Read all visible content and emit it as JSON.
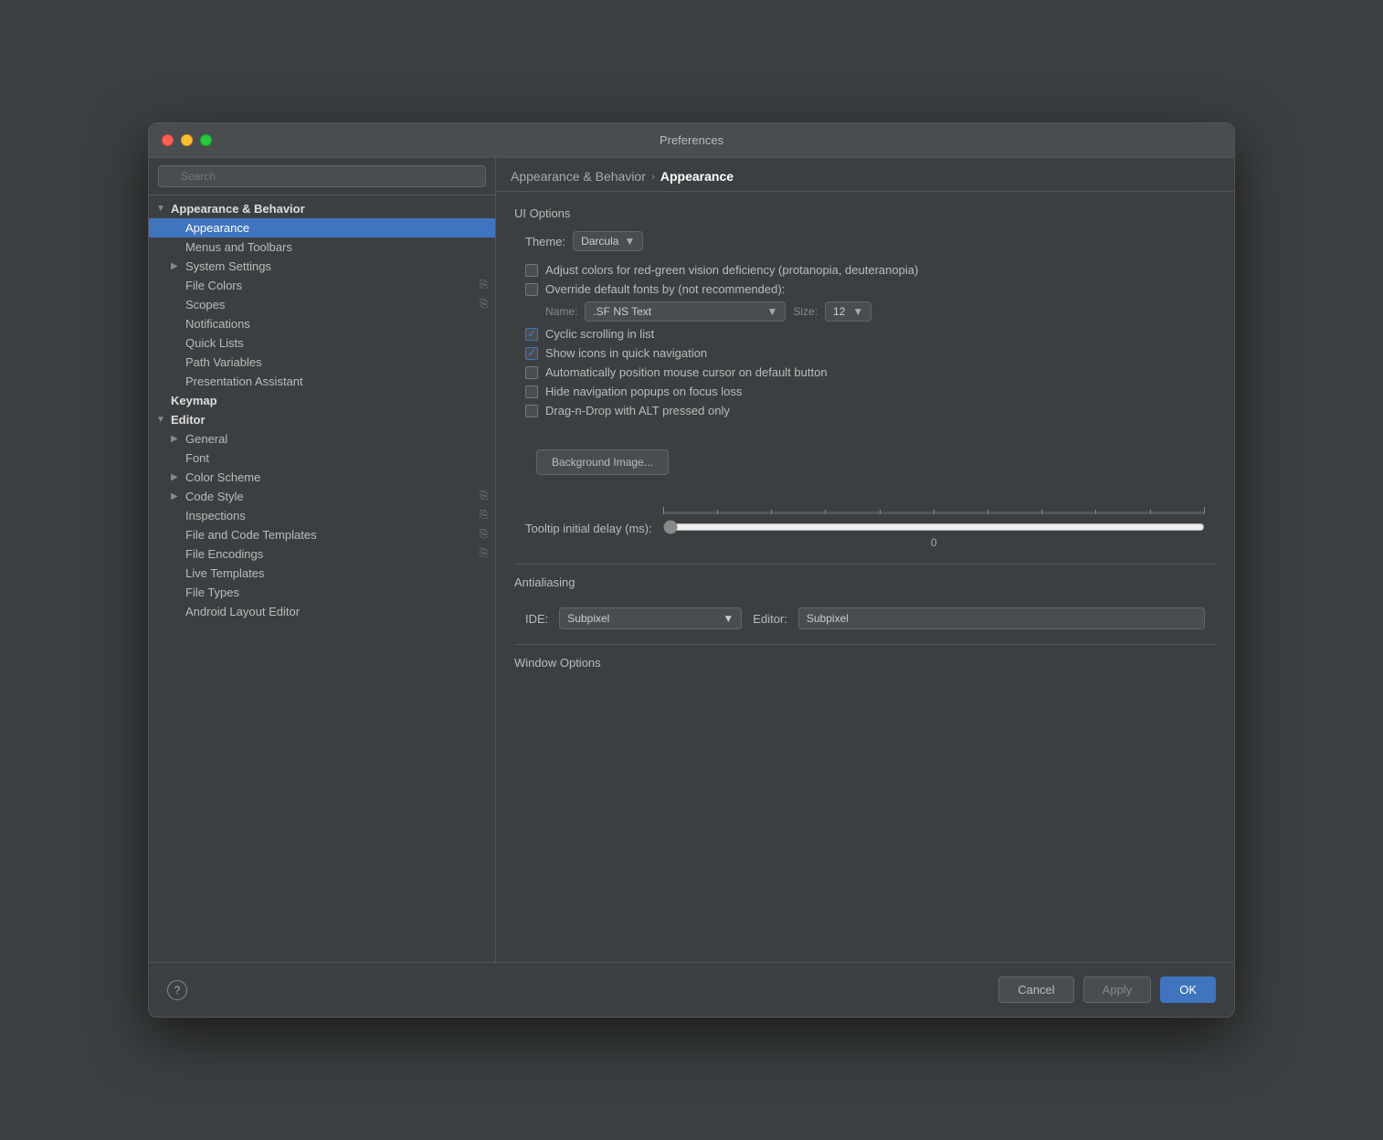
{
  "window": {
    "title": "Preferences"
  },
  "sidebar": {
    "search_placeholder": "🔍",
    "items": [
      {
        "id": "appearance-behavior",
        "label": "Appearance & Behavior",
        "indent": 0,
        "type": "expanded",
        "bold": true
      },
      {
        "id": "appearance",
        "label": "Appearance",
        "indent": 1,
        "type": "leaf",
        "selected": true
      },
      {
        "id": "menus-toolbars",
        "label": "Menus and Toolbars",
        "indent": 1,
        "type": "leaf"
      },
      {
        "id": "system-settings",
        "label": "System Settings",
        "indent": 1,
        "type": "collapsed"
      },
      {
        "id": "file-colors",
        "label": "File Colors",
        "indent": 1,
        "type": "leaf",
        "has_icon": true
      },
      {
        "id": "scopes",
        "label": "Scopes",
        "indent": 1,
        "type": "leaf",
        "has_icon": true
      },
      {
        "id": "notifications",
        "label": "Notifications",
        "indent": 1,
        "type": "leaf"
      },
      {
        "id": "quick-lists",
        "label": "Quick Lists",
        "indent": 1,
        "type": "leaf"
      },
      {
        "id": "path-variables",
        "label": "Path Variables",
        "indent": 1,
        "type": "leaf"
      },
      {
        "id": "presentation-assistant",
        "label": "Presentation Assistant",
        "indent": 1,
        "type": "leaf"
      },
      {
        "id": "keymap",
        "label": "Keymap",
        "indent": 0,
        "type": "leaf",
        "bold": true
      },
      {
        "id": "editor",
        "label": "Editor",
        "indent": 0,
        "type": "expanded",
        "bold": true
      },
      {
        "id": "general",
        "label": "General",
        "indent": 1,
        "type": "collapsed"
      },
      {
        "id": "font",
        "label": "Font",
        "indent": 1,
        "type": "leaf"
      },
      {
        "id": "color-scheme",
        "label": "Color Scheme",
        "indent": 1,
        "type": "collapsed"
      },
      {
        "id": "code-style",
        "label": "Code Style",
        "indent": 1,
        "type": "collapsed",
        "has_icon": true
      },
      {
        "id": "inspections",
        "label": "Inspections",
        "indent": 1,
        "type": "leaf",
        "has_icon": true
      },
      {
        "id": "file-code-templates",
        "label": "File and Code Templates",
        "indent": 1,
        "type": "leaf",
        "has_icon": true
      },
      {
        "id": "file-encodings",
        "label": "File Encodings",
        "indent": 1,
        "type": "leaf",
        "has_icon": true
      },
      {
        "id": "live-templates",
        "label": "Live Templates",
        "indent": 1,
        "type": "leaf"
      },
      {
        "id": "file-types",
        "label": "File Types",
        "indent": 1,
        "type": "leaf"
      },
      {
        "id": "android-layout-editor",
        "label": "Android Layout Editor",
        "indent": 1,
        "type": "leaf"
      }
    ]
  },
  "breadcrumb": {
    "parent": "Appearance & Behavior",
    "separator": "›",
    "current": "Appearance"
  },
  "content": {
    "section_ui": "UI Options",
    "theme_label": "Theme:",
    "theme_value": "Darcula",
    "checkboxes": [
      {
        "id": "red-green",
        "checked": false,
        "label": "Adjust colors for red-green vision deficiency (protanopia, deuteranopia)"
      },
      {
        "id": "override-fonts",
        "checked": false,
        "label": "Override default fonts by (not recommended):"
      },
      {
        "id": "cyclic-scrolling",
        "checked": true,
        "label": "Cyclic scrolling in list"
      },
      {
        "id": "show-icons",
        "checked": true,
        "label": "Show icons in quick navigation"
      },
      {
        "id": "auto-position-cursor",
        "checked": false,
        "label": "Automatically position mouse cursor on default button"
      },
      {
        "id": "hide-nav-popups",
        "checked": false,
        "label": "Hide navigation popups on focus loss"
      },
      {
        "id": "drag-drop-alt",
        "checked": false,
        "label": "Drag-n-Drop with ALT pressed only"
      }
    ],
    "font_name_label": "Name:",
    "font_name_value": ".SF NS Text",
    "font_size_label": "Size:",
    "font_size_value": "12",
    "bg_button_label": "Background Image...",
    "tooltip_label": "Tooltip initial delay (ms):",
    "tooltip_value": "0",
    "section_antialiasing": "Antialiasing",
    "ide_label": "IDE:",
    "ide_value": "Subpixel",
    "editor_label": "Editor:",
    "editor_value": "Subpixel",
    "section_window": "Window Options"
  },
  "buttons": {
    "cancel": "Cancel",
    "apply": "Apply",
    "ok": "OK",
    "help": "?"
  }
}
